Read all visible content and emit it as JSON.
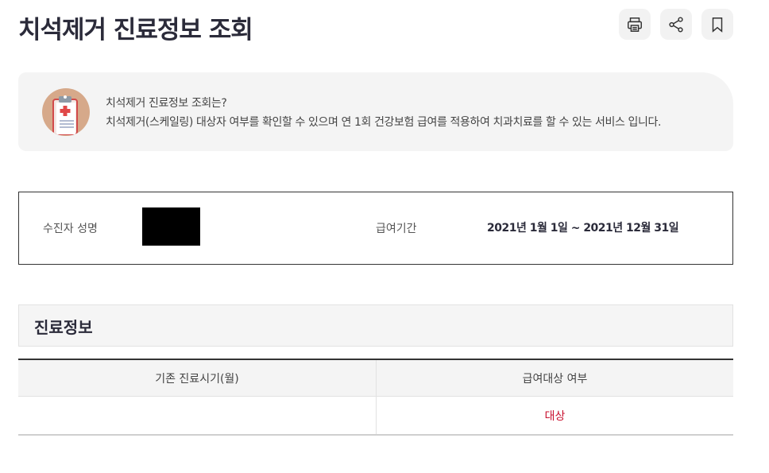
{
  "page": {
    "title": "치석제거 진료정보 조회"
  },
  "toolbar": {
    "print_icon": "printer-icon",
    "share_icon": "share-icon",
    "bookmark_icon": "bookmark-icon"
  },
  "info": {
    "icon": "clipboard-medical-icon",
    "heading": "치석제거 진료정보 조회는?",
    "description": "치석제거(스케일링) 대상자 여부를 확인할 수 있으며 연 1회 건강보험 급여를 적용하여 치과치료를 할 수 있는 서비스 입니다."
  },
  "patient": {
    "name_label": "수진자 성명",
    "period_label": "급여기간",
    "period_value": "2021년 1월 1일 ~ 2021년 12월 31일"
  },
  "section": {
    "title": "진료정보"
  },
  "table": {
    "headers": [
      "기존 진료시기(월)",
      "급여대상 여부"
    ],
    "rows": [
      [
        "",
        "대상"
      ]
    ]
  },
  "colors": {
    "status_target": "#c8102e",
    "title": "#2b2b3a"
  }
}
